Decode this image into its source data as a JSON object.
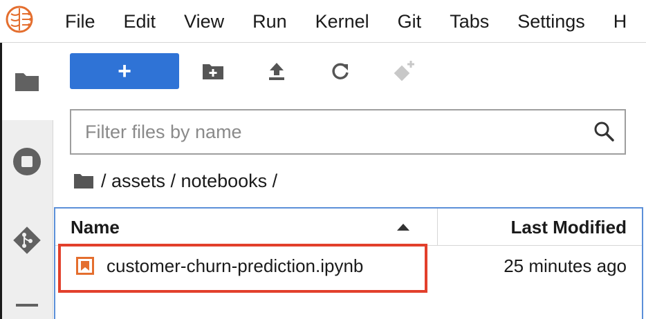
{
  "menubar": {
    "logo_icon": "jupyter-brain-logo-icon",
    "items": [
      "File",
      "Edit",
      "View",
      "Run",
      "Kernel",
      "Git",
      "Tabs",
      "Settings",
      "H"
    ]
  },
  "sidebar": {
    "tabs": [
      {
        "icon": "folder-icon",
        "active": true
      },
      {
        "icon": "stop-circle-icon",
        "active": false
      },
      {
        "icon": "git-icon",
        "active": false
      },
      {
        "icon": "list-icon",
        "active": false
      }
    ]
  },
  "toolbar": {
    "new_launcher_label": "+",
    "buttons": [
      "new-folder-icon",
      "upload-icon",
      "refresh-icon",
      "git-clone-icon"
    ]
  },
  "filter": {
    "placeholder": "Filter files by name",
    "value": ""
  },
  "breadcrumb": {
    "root_icon": "folder-icon",
    "path": "/ assets / notebooks /"
  },
  "listing": {
    "columns": {
      "name": "Name",
      "modified": "Last Modified"
    },
    "sort": "ascending",
    "rows": [
      {
        "name": "customer-churn-prediction.ipynb",
        "modified": "25 minutes ago",
        "icon": "notebook-icon"
      }
    ]
  },
  "colors": {
    "accent": "#2f73d6",
    "highlight": "#e2402c",
    "notebook_icon": "#e46e2e",
    "listing_border": "#5b8fd8"
  }
}
